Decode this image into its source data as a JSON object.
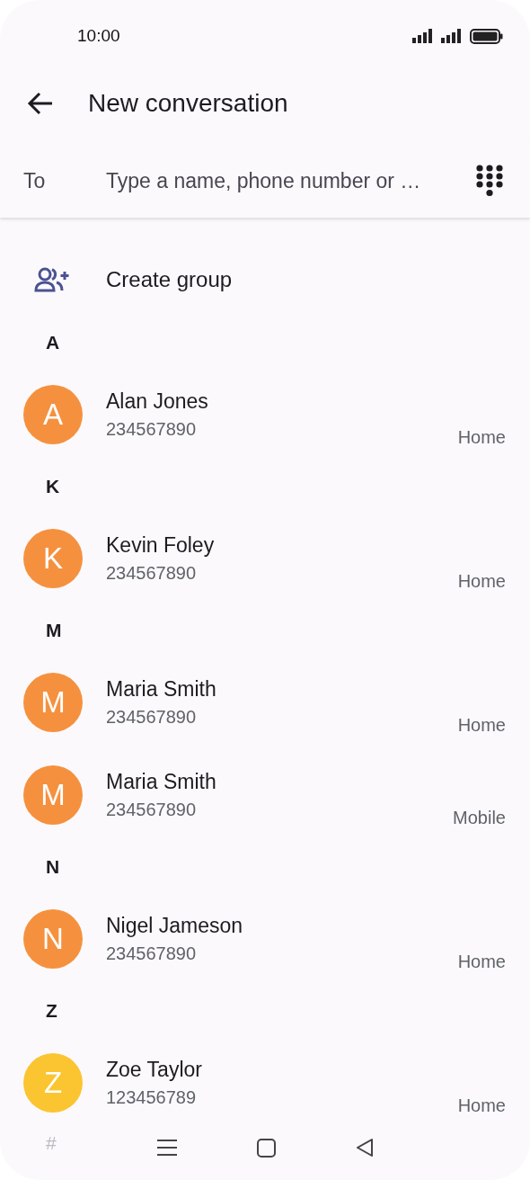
{
  "status_bar": {
    "time": "10:00"
  },
  "header": {
    "title": "New conversation"
  },
  "recipient": {
    "label": "To",
    "placeholder": "Type a name, phone number or …"
  },
  "create_group": {
    "label": "Create group"
  },
  "sections": [
    {
      "letter": "A",
      "contacts": [
        {
          "initial": "A",
          "name": "Alan Jones",
          "number": "234567890",
          "type": "Home",
          "color": "#f5913e"
        }
      ]
    },
    {
      "letter": "K",
      "contacts": [
        {
          "initial": "K",
          "name": "Kevin Foley",
          "number": "234567890",
          "type": "Home",
          "color": "#f5913e"
        }
      ]
    },
    {
      "letter": "M",
      "contacts": [
        {
          "initial": "M",
          "name": "Maria Smith",
          "number": "234567890",
          "type": "Home",
          "color": "#f5913e"
        },
        {
          "initial": "M",
          "name": "Maria Smith",
          "number": "234567890",
          "type": "Mobile",
          "color": "#f5913e"
        }
      ]
    },
    {
      "letter": "N",
      "contacts": [
        {
          "initial": "N",
          "name": "Nigel Jameson",
          "number": "234567890",
          "type": "Home",
          "color": "#f5913e"
        }
      ]
    },
    {
      "letter": "Z",
      "contacts": [
        {
          "initial": "Z",
          "name": "Zoe Taylor",
          "number": "123456789",
          "type": "Home",
          "color": "#fbc531"
        }
      ]
    },
    {
      "letter": "#"
    }
  ]
}
